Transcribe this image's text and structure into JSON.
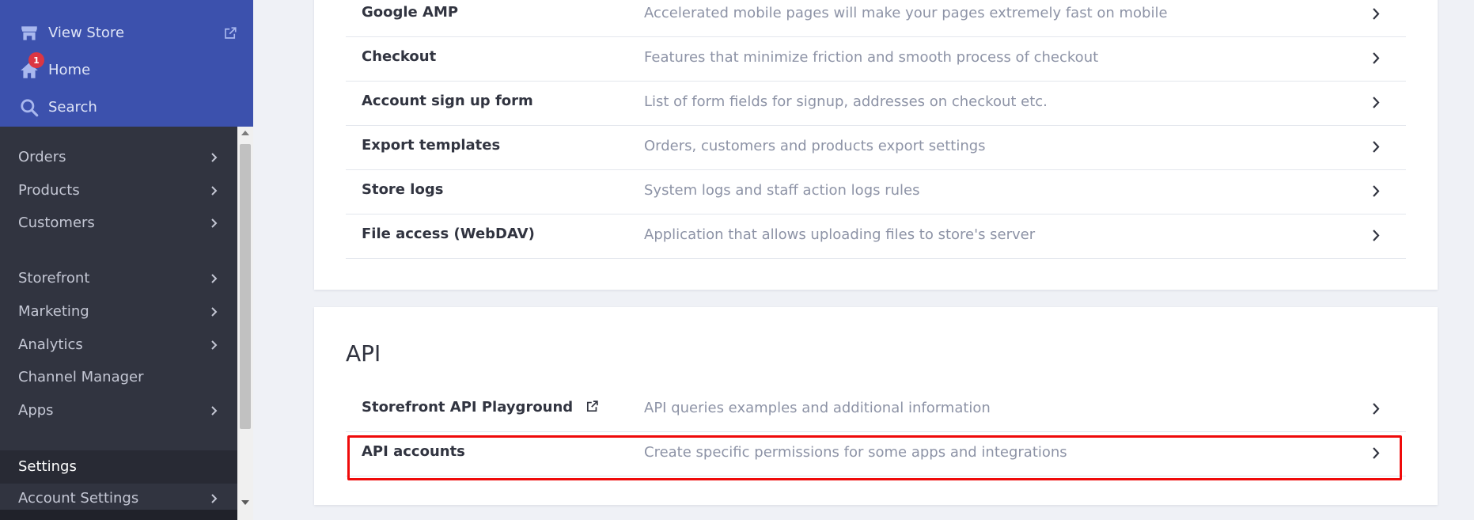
{
  "sidebar": {
    "top_links": [
      {
        "label": "View Store",
        "icon": "store-icon",
        "external_icon": "external-link-icon"
      },
      {
        "label": "Home",
        "icon": "home-icon",
        "badge": "1"
      },
      {
        "label": "Search",
        "icon": "search-icon"
      }
    ],
    "nav_items": [
      {
        "label": "Orders"
      },
      {
        "label": "Products"
      },
      {
        "label": "Customers"
      },
      {
        "label": "Storefront"
      },
      {
        "label": "Marketing"
      },
      {
        "label": "Analytics"
      },
      {
        "label": "Channel Manager"
      },
      {
        "label": "Apps"
      },
      {
        "label": "Settings"
      },
      {
        "label": "Account Settings"
      }
    ]
  },
  "settings_card": {
    "rows": [
      {
        "title": "Google AMP",
        "description": "Accelerated mobile pages will make your pages extremely fast on mobile"
      },
      {
        "title": "Checkout",
        "description": "Features that minimize friction and smooth process of checkout"
      },
      {
        "title": "Account sign up form",
        "description": "List of form fields for signup, addresses on checkout etc."
      },
      {
        "title": "Export templates",
        "description": "Orders, customers and products export settings"
      },
      {
        "title": "Store logs",
        "description": "System logs and staff action logs rules"
      },
      {
        "title": "File access (WebDAV)",
        "description": "Application that allows uploading files to store's server"
      }
    ]
  },
  "api_card": {
    "heading": "API",
    "rows": [
      {
        "title": "Storefront API Playground",
        "description": "API queries examples and additional information",
        "external_icon": "external-link-icon"
      },
      {
        "title": "API accounts",
        "description": "Create specific permissions for some apps and integrations"
      }
    ]
  },
  "colors": {
    "sidebar_top": "#3c51ad",
    "sidebar": "#313440",
    "highlight": "#ef0a0a",
    "badge": "#db3643"
  }
}
